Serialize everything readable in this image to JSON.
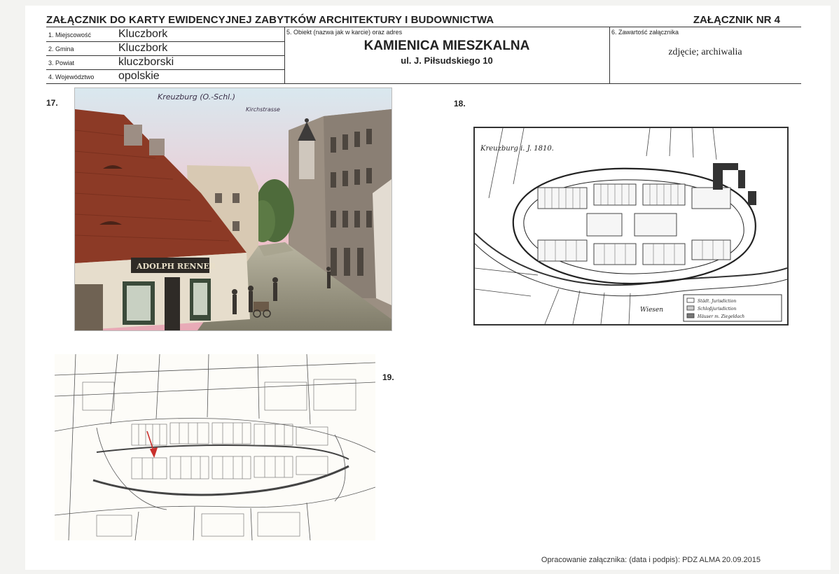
{
  "header": {
    "title": "ZAŁĄCZNIK DO KARTY EWIDENCYJNEJ ZABYTKÓW ARCHITEKTURY I BUDOWNICTWA",
    "attachment_no": "ZAŁĄCZNIK NR 4"
  },
  "form": {
    "fields": [
      {
        "label": "1. Miejscowość",
        "value": "Kluczbork"
      },
      {
        "label": "2. Gmina",
        "value": "Kluczbork"
      },
      {
        "label": "3. Powiat",
        "value": "kluczborski"
      },
      {
        "label": "4. Województwo",
        "value": "opolskie"
      }
    ],
    "object_label": "5. Obiekt (nazwa jak w karcie) oraz adres",
    "object_name": "KAMIENICA MIESZKALNA",
    "object_address": "ul. J. Piłsudskiego 10",
    "contents_label": "6. Zawartość załącznika",
    "contents_value": "zdjęcie; archiwalia"
  },
  "figures": {
    "fig17": {
      "number": "17.",
      "postcard_title": "Kreuzburg (O.-Schl.)",
      "postcard_subtitle": "Kirchstrasse",
      "shop_sign": "ADOLPH RENNER"
    },
    "fig18": {
      "number": "18.",
      "map_title": "Kreuzburg i. J. 1810.",
      "legend": [
        "Städt. Jurisdiction",
        "Schloßjurisdiction",
        "Häuser m. Ziegeldach"
      ],
      "map_label": "Wiesen"
    },
    "fig19": {
      "number": "19."
    }
  },
  "footer": {
    "text": "Opracowanie załącznika: (data i podpis): PDZ ALMA 20.09.2015"
  },
  "colors": {
    "roof": "#8c3a26",
    "sky_top": "#d9e8ef",
    "sky_pink": "#e8a9b6",
    "street": "#8e8a78",
    "ink": "#2b2b2b"
  }
}
